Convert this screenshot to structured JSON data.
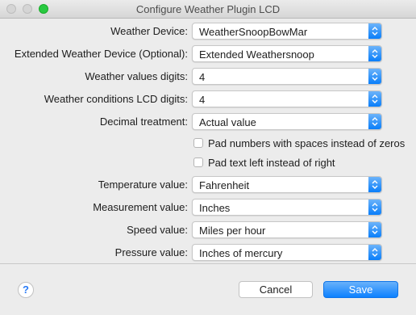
{
  "window": {
    "title": "Configure Weather Plugin LCD"
  },
  "fields": [
    {
      "label": "Weather Device:",
      "value": "WeatherSnoopBowMar"
    },
    {
      "label": "Extended Weather Device (Optional):",
      "value": "Extended Weathersnoop"
    },
    {
      "label": "Weather values digits:",
      "value": "4"
    },
    {
      "label": "Weather conditions LCD digits:",
      "value": "4"
    },
    {
      "label": "Decimal treatment:",
      "value": "Actual value"
    }
  ],
  "checkboxes": [
    {
      "label": "Pad numbers with spaces instead of zeros",
      "checked": false
    },
    {
      "label": "Pad text left instead of right",
      "checked": false
    }
  ],
  "units": [
    {
      "label": "Temperature value:",
      "value": "Fahrenheit"
    },
    {
      "label": "Measurement value:",
      "value": "Inches"
    },
    {
      "label": "Speed value:",
      "value": "Miles per hour"
    },
    {
      "label": "Pressure value:",
      "value": "Inches of mercury"
    }
  ],
  "footer": {
    "help_label": "?",
    "cancel_label": "Cancel",
    "save_label": "Save"
  },
  "colors": {
    "accent": "#0d81ff",
    "zoom_button": "#28c940"
  }
}
